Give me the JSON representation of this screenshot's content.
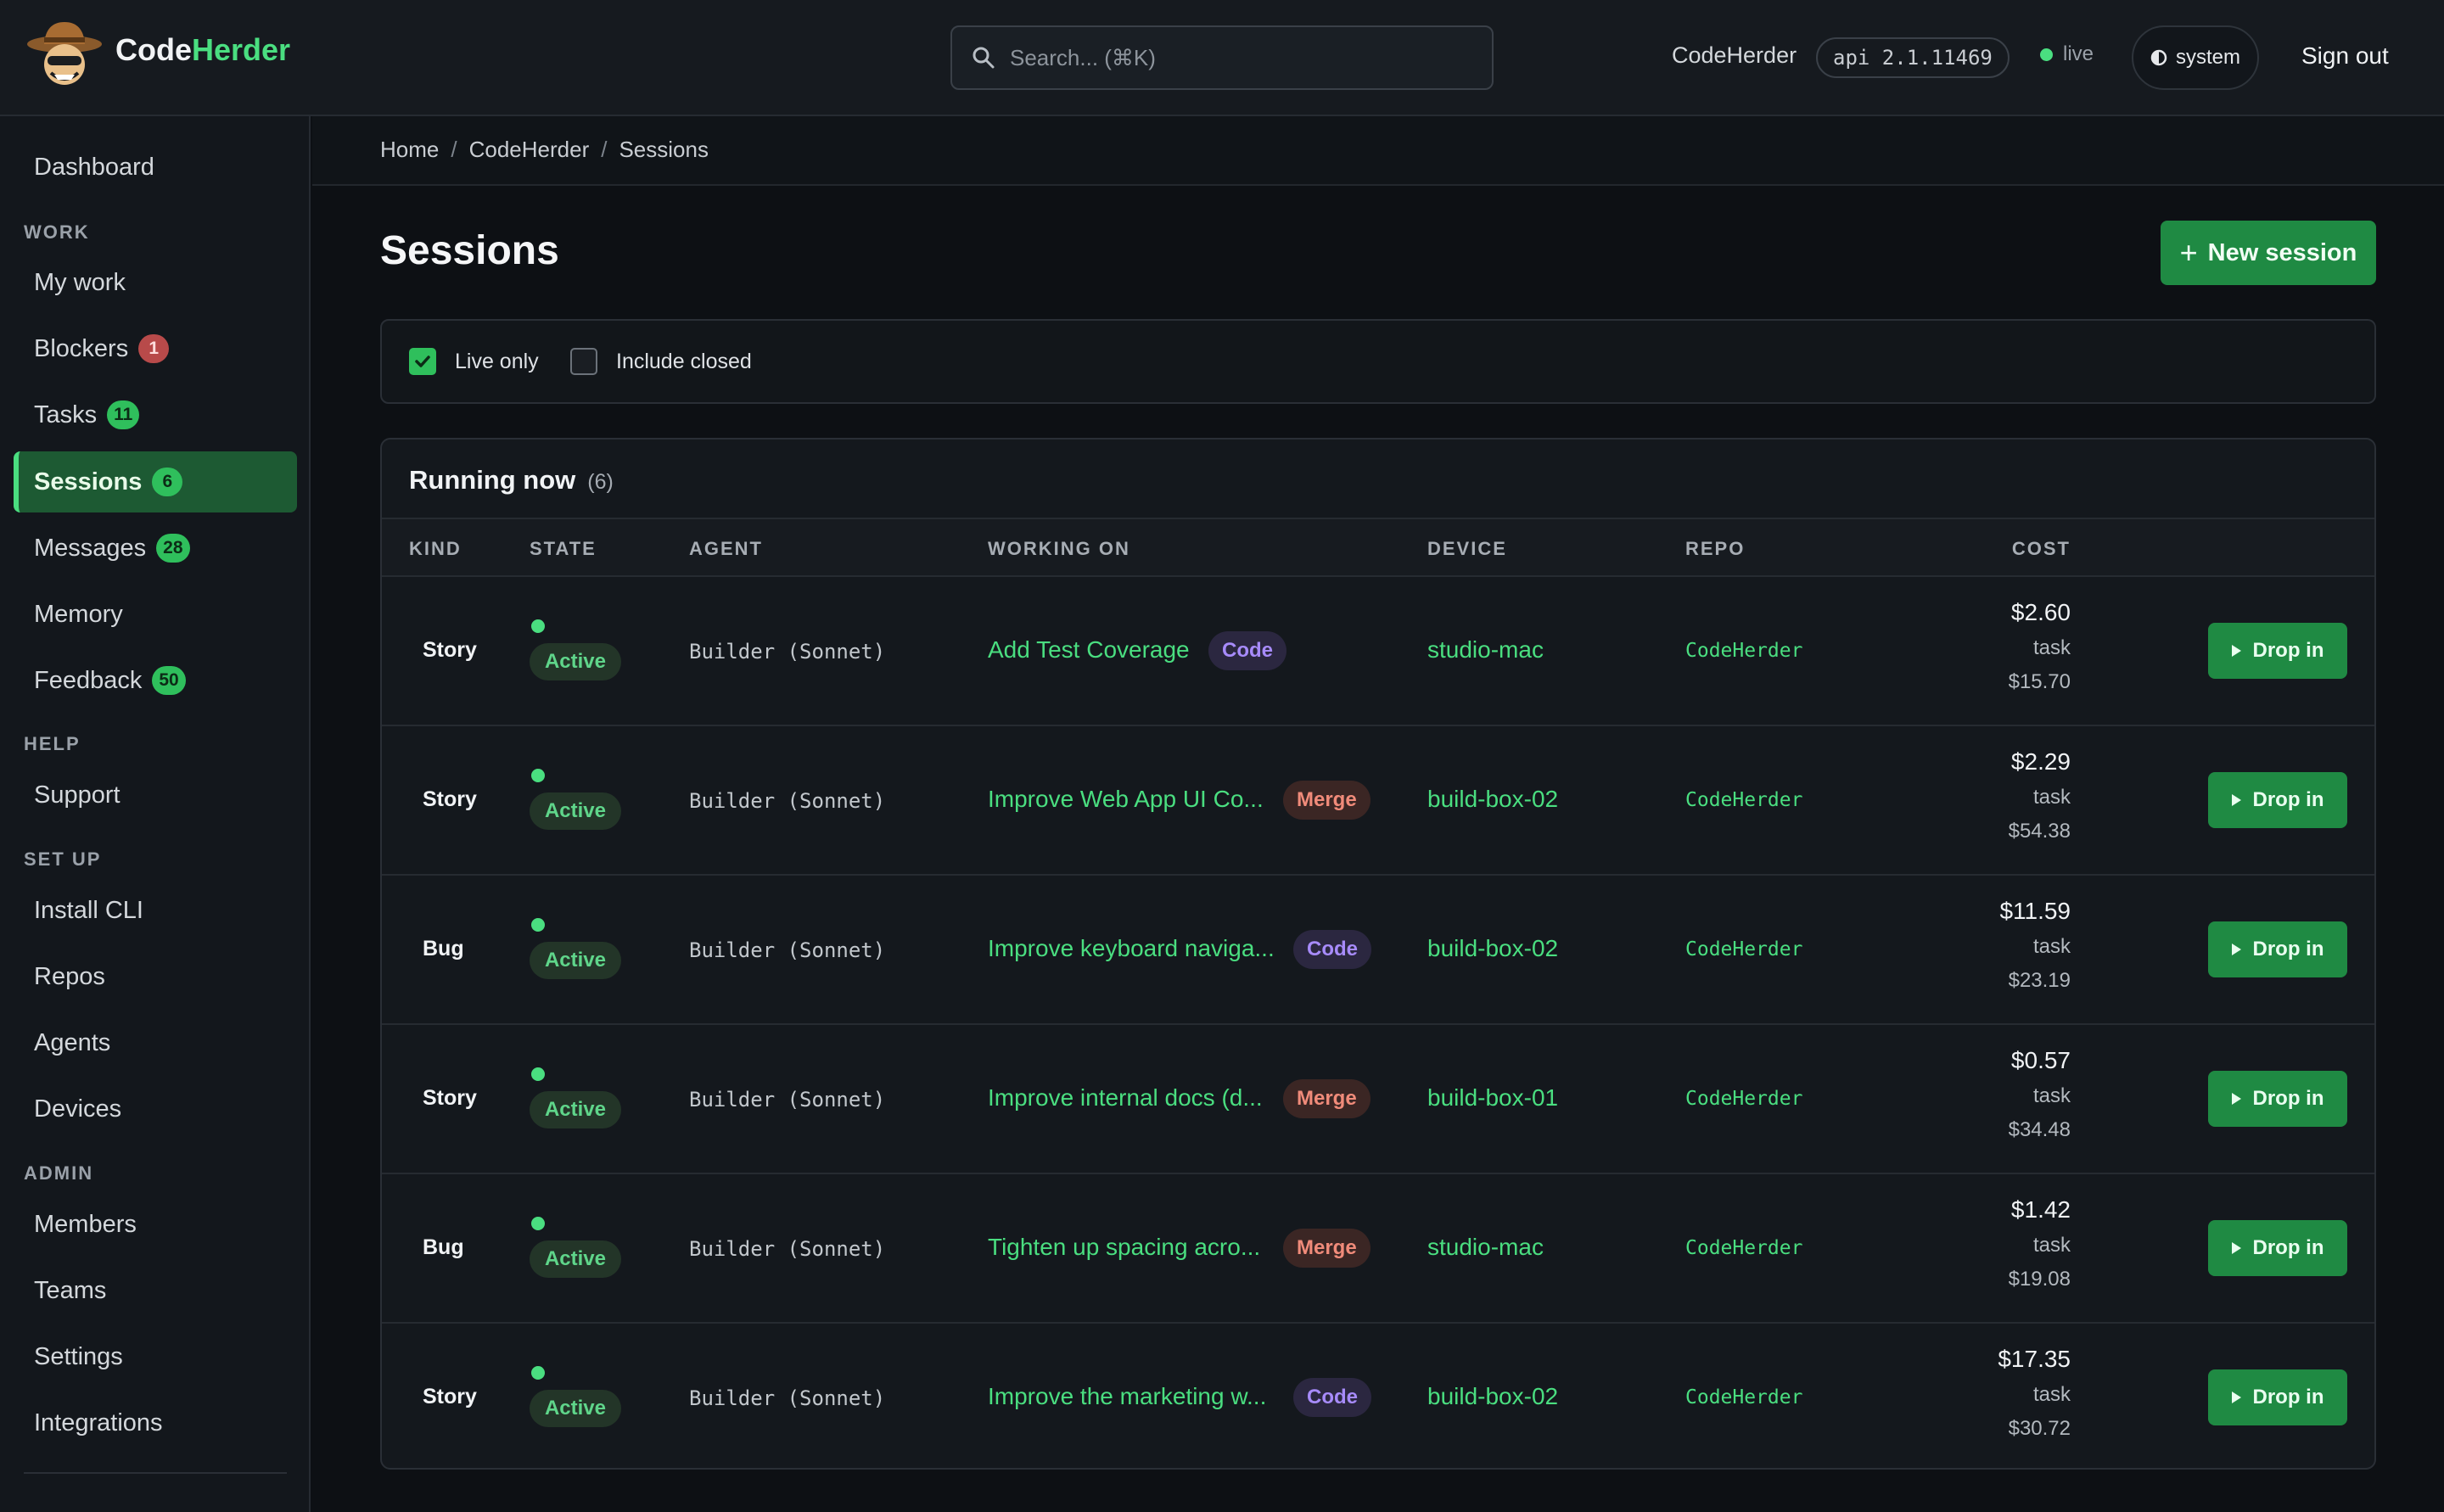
{
  "header": {
    "brand_a": "Code",
    "brand_b": "Herder",
    "search_placeholder": "Search... (⌘K)",
    "org": "CodeHerder",
    "api_version": "api 2.1.11469",
    "status": "live",
    "theme": "system",
    "sign_out": "Sign out",
    "icons": [
      "cowboy-logo-icon",
      "search-icon",
      "theme-half-circle-icon"
    ]
  },
  "sidebar": {
    "dashboard": "Dashboard",
    "sections": {
      "work": "WORK",
      "help": "HELP",
      "setup": "SET UP",
      "admin": "ADMIN"
    },
    "work_items": [
      {
        "label": "My work",
        "badge": ""
      },
      {
        "label": "Blockers",
        "badge": "1"
      },
      {
        "label": "Tasks",
        "badge": "11"
      },
      {
        "label": "Sessions",
        "badge": "6"
      },
      {
        "label": "Messages",
        "badge": "28"
      },
      {
        "label": "Memory",
        "badge": ""
      },
      {
        "label": "Feedback",
        "badge": "50"
      }
    ],
    "help_items": [
      {
        "label": "Support"
      }
    ],
    "setup_items": [
      {
        "label": "Install CLI"
      },
      {
        "label": "Repos"
      },
      {
        "label": "Agents"
      },
      {
        "label": "Devices"
      }
    ],
    "admin_items": [
      {
        "label": "Members"
      },
      {
        "label": "Teams"
      },
      {
        "label": "Settings"
      },
      {
        "label": "Integrations"
      }
    ],
    "active": "Sessions"
  },
  "breadcrumb": [
    "Home",
    "CodeHerder",
    "Sessions"
  ],
  "page": {
    "title": "Sessions",
    "new_button": "New session"
  },
  "filters": {
    "live_only": {
      "label": "Live only",
      "checked": true
    },
    "include_closed": {
      "label": "Include closed",
      "checked": false
    }
  },
  "table": {
    "title": "Running now",
    "count": "(6)",
    "columns": [
      "KIND",
      "STATE",
      "AGENT",
      "WORKING ON",
      "DEVICE",
      "REPO",
      "COST"
    ],
    "drop_in_label": "Drop in",
    "rows": [
      {
        "kind": "Story",
        "state": "Active",
        "agent": "Builder (Sonnet)",
        "working_on": "Add Test Coverage",
        "tag": "Code",
        "device": "studio-mac",
        "repo": "CodeHerder",
        "cost": "$2.60",
        "cost_label": "task",
        "task_cost": "$15.70"
      },
      {
        "kind": "Story",
        "state": "Active",
        "agent": "Builder (Sonnet)",
        "working_on": "Improve Web App UI Co...",
        "tag": "Merge",
        "device": "build-box-02",
        "repo": "CodeHerder",
        "cost": "$2.29",
        "cost_label": "task",
        "task_cost": "$54.38"
      },
      {
        "kind": "Bug",
        "state": "Active",
        "agent": "Builder (Sonnet)",
        "working_on": "Improve keyboard naviga...",
        "tag": "Code",
        "device": "build-box-02",
        "repo": "CodeHerder",
        "cost": "$11.59",
        "cost_label": "task",
        "task_cost": "$23.19"
      },
      {
        "kind": "Story",
        "state": "Active",
        "agent": "Builder (Sonnet)",
        "working_on": "Improve internal docs (d...",
        "tag": "Merge",
        "device": "build-box-01",
        "repo": "CodeHerder",
        "cost": "$0.57",
        "cost_label": "task",
        "task_cost": "$34.48"
      },
      {
        "kind": "Bug",
        "state": "Active",
        "agent": "Builder (Sonnet)",
        "working_on": "Tighten up spacing acro...",
        "tag": "Merge",
        "device": "studio-mac",
        "repo": "CodeHerder",
        "cost": "$1.42",
        "cost_label": "task",
        "task_cost": "$19.08"
      },
      {
        "kind": "Story",
        "state": "Active",
        "agent": "Builder (Sonnet)",
        "working_on": "Improve the marketing w...",
        "tag": "Code",
        "device": "build-box-02",
        "repo": "CodeHerder",
        "cost": "$17.35",
        "cost_label": "task",
        "task_cost": "$30.72"
      }
    ]
  },
  "colors": {
    "accent": "#4ade80",
    "primary_button": "#1f8a43",
    "active_nav": "#1d5a33",
    "code_tag": "#a78bfa",
    "merge_tag": "#f08b7a",
    "blocker_badge": "#b84a4a"
  }
}
